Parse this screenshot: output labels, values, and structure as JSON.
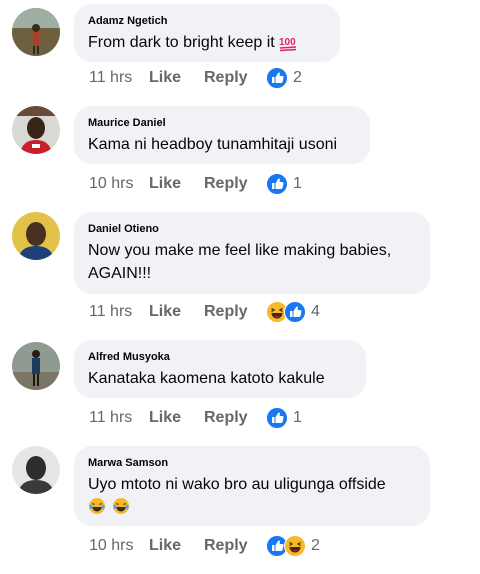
{
  "comments": [
    {
      "author": "Adamz Ngetich",
      "text": "From dark to bright  keep it",
      "emoji": "hundred-points-icon",
      "time": "11 hrs",
      "like": "Like",
      "reply": "Reply",
      "reactions": [
        "like-reaction-icon"
      ],
      "count": "2"
    },
    {
      "author": "Maurice Daniel",
      "text": "Kama ni headboy tunamhitaji usoni",
      "time": "10 hrs",
      "like": "Like",
      "reply": "Reply",
      "reactions": [
        "like-reaction-icon"
      ],
      "count": "1"
    },
    {
      "author": "Daniel Otieno",
      "text": "Now you make me feel like making babies, AGAIN!!!",
      "time": "11 hrs",
      "like": "Like",
      "reply": "Reply",
      "reactions": [
        "haha-reaction-icon",
        "like-reaction-icon"
      ],
      "count": "4"
    },
    {
      "author": "Alfred Musyoka",
      "text": "Kanataka kaomena katoto kakule",
      "time": "11 hrs",
      "like": "Like",
      "reply": "Reply",
      "reactions": [
        "like-reaction-icon"
      ],
      "count": "1"
    },
    {
      "author": "Marwa Samson",
      "text": "Uyo mtoto ni wako bro au uligunga offside",
      "emojis_line": [
        "tears-of-joy-icon",
        "tears-of-joy-icon"
      ],
      "time": "10 hrs",
      "like": "Like",
      "reply": "Reply",
      "reactions": [
        "like-reaction-icon",
        "haha-reaction-icon"
      ],
      "count": "2"
    }
  ],
  "colors": {
    "bubble": "#f0f2f5",
    "meta": "#65676b",
    "like_blue": "#1877f2",
    "haha_yellow": "#f7b928"
  }
}
